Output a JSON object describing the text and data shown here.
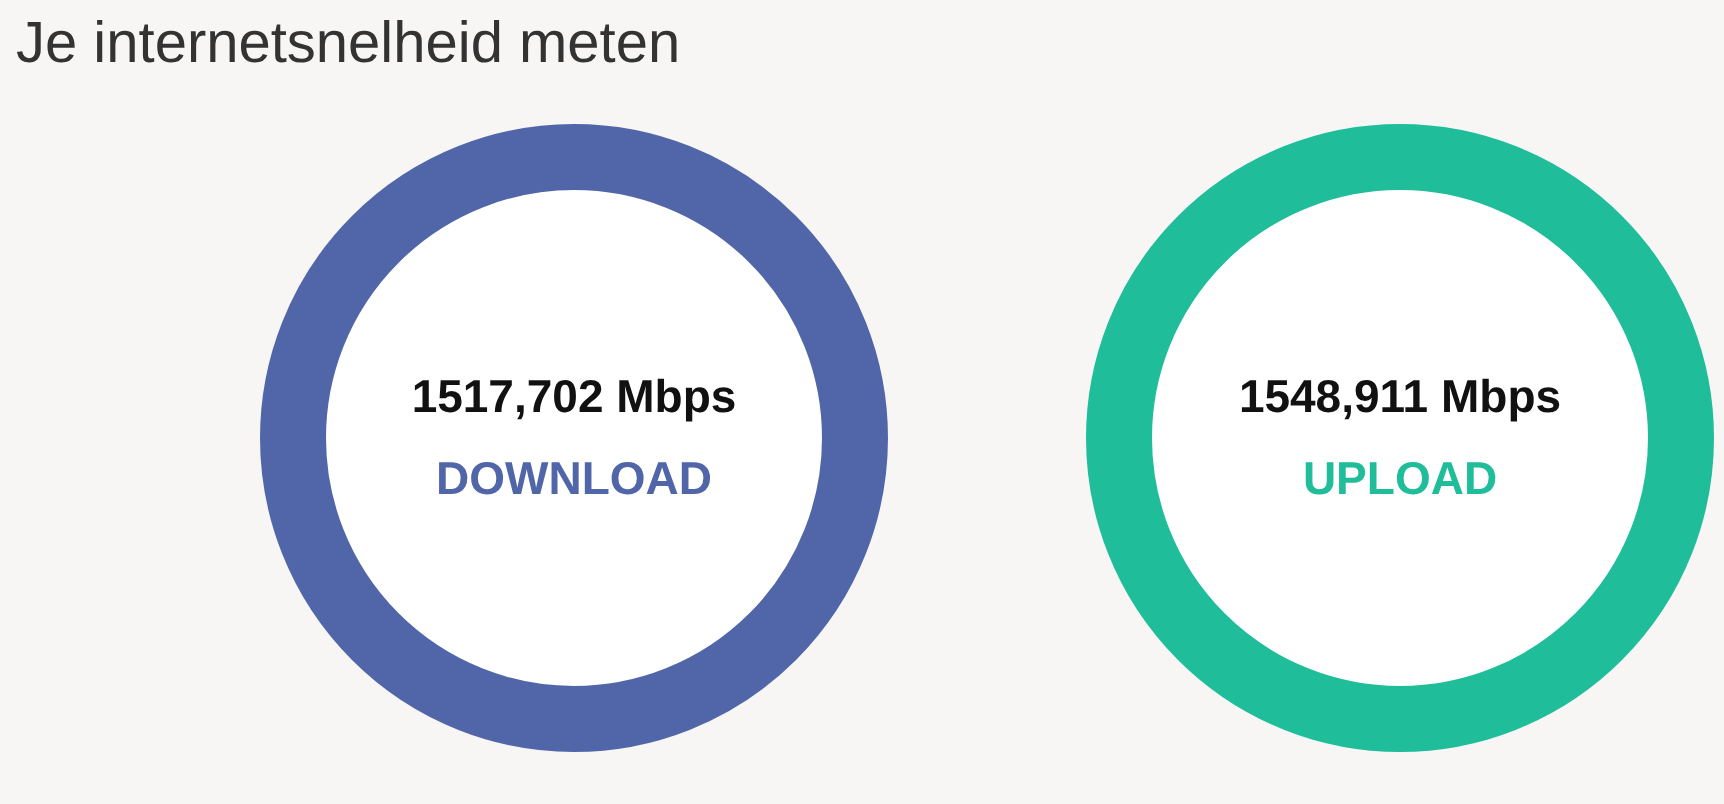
{
  "title": "Je internetsnelheid meten",
  "meters": [
    {
      "value": "1517,702 Mbps",
      "label": "DOWNLOAD",
      "color": "#5066a8"
    },
    {
      "value": "1548,911 Mbps",
      "label": "UPLOAD",
      "color": "#1fbd9a"
    }
  ]
}
